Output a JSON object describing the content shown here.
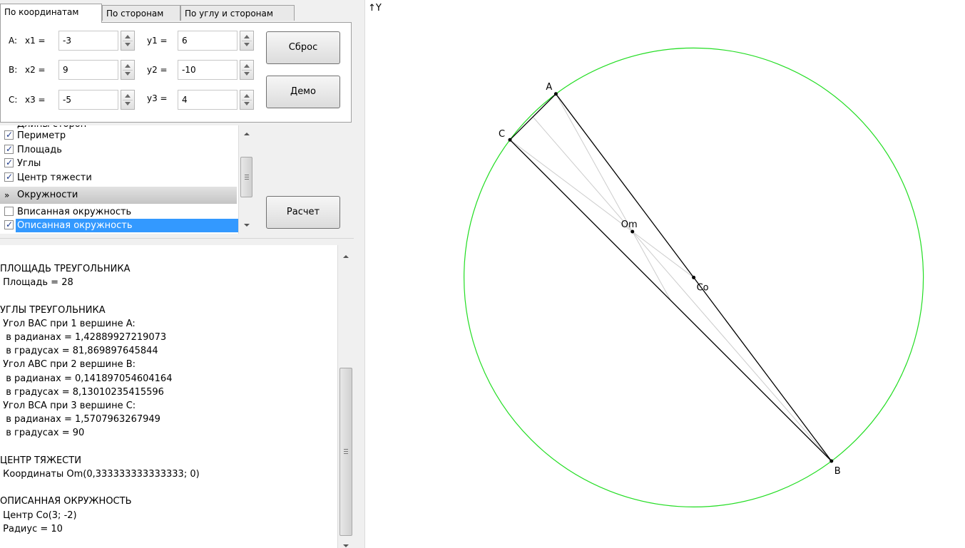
{
  "tabs": [
    "По координатам",
    "По сторонам",
    "По углу и сторонам"
  ],
  "coords": {
    "a_label": "A:",
    "x1_label": "x1 =",
    "x1": "-3",
    "y1_label": "y1 =",
    "y1": "6",
    "b_label": "B:",
    "x2_label": "x2 =",
    "x2": "9",
    "y2_label": "y2 =",
    "y2": "-10",
    "c_label": "C:",
    "x3_label": "x3 =",
    "x3": "-5",
    "y3_label": "y3 =",
    "y3": "4"
  },
  "buttons": {
    "reset": "Сброс",
    "demo": "Демо",
    "calc": "Расчет"
  },
  "checklist": {
    "partial_top": "Длины сторон",
    "items": [
      {
        "label": "Периметр",
        "checked": true
      },
      {
        "label": "Площадь",
        "checked": true
      },
      {
        "label": "Углы",
        "checked": true
      },
      {
        "label": "Центр тяжести",
        "checked": true
      }
    ],
    "group": "Окружности",
    "group_items": [
      {
        "label": "Вписанная окружность",
        "checked": false
      },
      {
        "label": "Описанная окружность",
        "checked": true,
        "selected": true
      }
    ]
  },
  "output": {
    "lines": [
      "ПЛОЩАДЬ ТРЕУГОЛЬНИКА",
      " Площадь = 28",
      "",
      "УГЛЫ ТРЕУГОЛЬНИКА",
      " Угол BAC при 1 вершине A:",
      "  в радианах = 1,42889927219073",
      "  в градусах = 81,869897645844",
      " Угол ABC при 2 вершине B:",
      "  в радианах = 0,141897054604164",
      "  в градусах = 8,13010235415596",
      " Угол BCA при 3 вершине C:",
      "  в радианах = 1,5707963267949",
      "  в градусах = 90",
      "",
      "ЦЕНТР ТЯЖЕСТИ",
      " Координаты Om(0,333333333333333; 0)",
      "",
      "ОПИСАННАЯ ОКРУЖНОСТЬ",
      " Центр Co(3; -2)",
      " Радиус = 10"
    ]
  },
  "plot": {
    "axis_label": "↑Y",
    "points": [
      {
        "name": "A",
        "x": -3,
        "y": 6
      },
      {
        "name": "B",
        "x": 9,
        "y": -10
      },
      {
        "name": "C",
        "x": -5,
        "y": 4
      },
      {
        "name": "Om",
        "x": 0.333333333333333,
        "y": 0
      },
      {
        "name": "Co",
        "x": 3,
        "y": -2
      }
    ],
    "circle_radius": 10,
    "colors": {
      "circle": "#22dd22",
      "triangle": "#000000",
      "medians": "#cccccc"
    }
  }
}
